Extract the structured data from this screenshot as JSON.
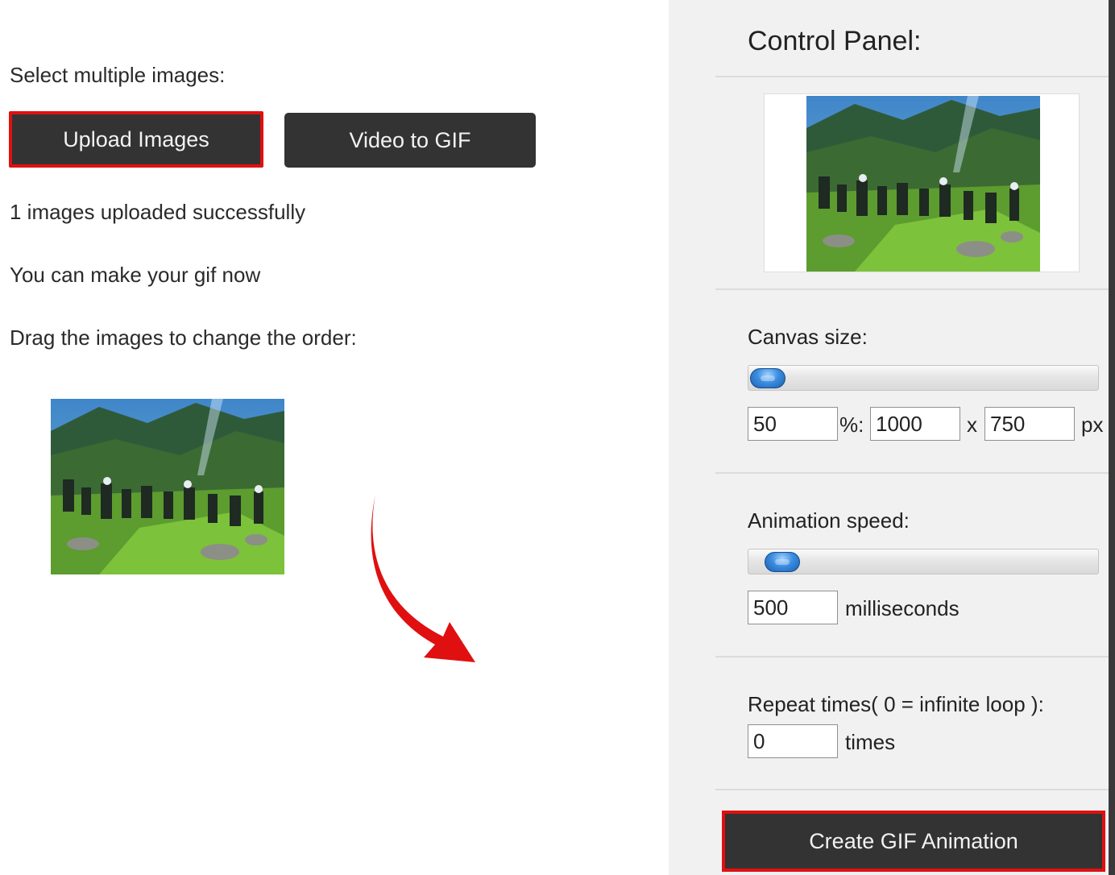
{
  "left": {
    "select_label": "Select multiple images:",
    "upload_button": "Upload Images",
    "video_button": "Video to GIF",
    "status_uploaded": "1 images uploaded successfully",
    "status_ready": "You can make your gif now",
    "drag_hint": "Drag the images to change the order:"
  },
  "panel": {
    "title": "Control Panel:",
    "canvas": {
      "label": "Canvas size:",
      "percent": "50",
      "percent_sep": "%:",
      "width": "1000",
      "times_sep": "x",
      "height": "750",
      "unit": "px"
    },
    "speed": {
      "label": "Animation speed:",
      "value": "500",
      "unit": "milliseconds"
    },
    "repeat": {
      "label": "Repeat times( 0 = infinite loop ):",
      "value": "0",
      "unit": "times"
    },
    "create_button": "Create GIF Animation"
  },
  "colors": {
    "highlight": "#e01010",
    "button_bg": "#333333",
    "panel_bg": "#f1f1f1",
    "arrow": "#e01010"
  },
  "icons": [
    "red-curved-arrow-icon",
    "slider-handle-icon"
  ]
}
